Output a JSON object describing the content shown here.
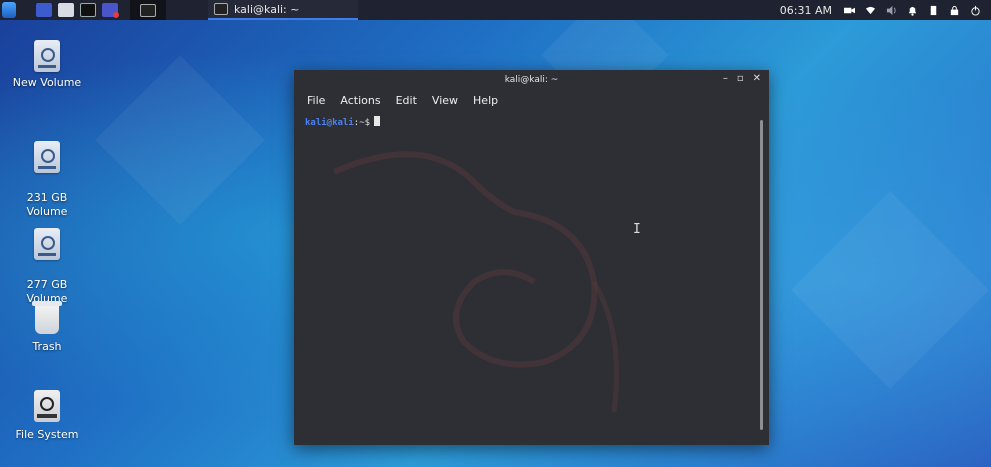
{
  "taskbar": {
    "launchers": [
      "kali-menu-icon",
      "workspace-icon",
      "file-manager-icon",
      "terminal-icon",
      "screen-recorder-icon"
    ],
    "task_title": "kali@kali: ~",
    "clock": "06:31 AM"
  },
  "desktop": {
    "icons": [
      {
        "label": "New Volume"
      },
      {
        "label": "231 GB\nVolume"
      },
      {
        "label": "277 GB\nVolume"
      },
      {
        "label": "Trash"
      },
      {
        "label": "File System"
      }
    ]
  },
  "terminal": {
    "title": "kali@kali: ~",
    "menu": [
      "File",
      "Actions",
      "Edit",
      "View",
      "Help"
    ],
    "prompt_user": "kali@kali",
    "prompt_sep": ":~$",
    "controls": {
      "minimize": "–",
      "maximize": "▫",
      "close": "✕"
    }
  },
  "colors": {
    "panel": "#1f2230",
    "terminal_bg": "#2d2f34",
    "prompt_user": "#4c82f0"
  }
}
